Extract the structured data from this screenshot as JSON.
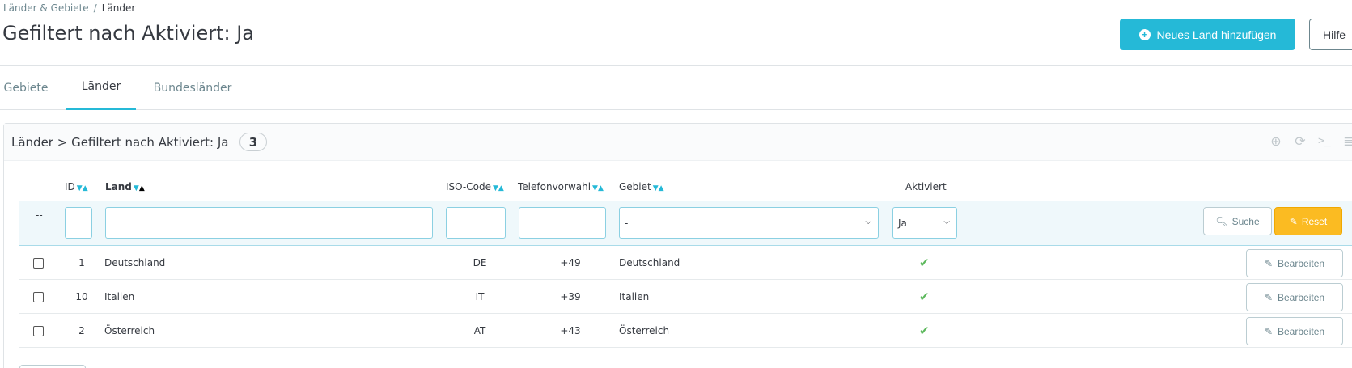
{
  "breadcrumb": {
    "parent": "Länder & Gebiete",
    "separator": "/",
    "current": "Länder"
  },
  "page": {
    "title": "Gefiltert nach Aktiviert: Ja"
  },
  "toolbar": {
    "add_label": "Neues Land hinzufügen",
    "help_label": "Hilfe"
  },
  "tabs": [
    {
      "label": "Gebiete",
      "active": false
    },
    {
      "label": "Länder",
      "active": true
    },
    {
      "label": "Bundesländer",
      "active": false
    }
  ],
  "panel": {
    "title": "Länder > Gefiltert nach Aktiviert: Ja",
    "count": "3",
    "tool_icons": [
      "add-circle-icon",
      "refresh-icon",
      "terminal-icon",
      "database-icon"
    ]
  },
  "table": {
    "columns": {
      "id": "ID",
      "land": "Land",
      "iso": "ISO-Code",
      "phone": "Telefonvorwahl",
      "zone": "Gebiet",
      "active": "Aktiviert"
    },
    "filters": {
      "bulk_dash": "--",
      "id_value": "",
      "land_value": "",
      "iso_value": "",
      "phone_value": "",
      "zone_selected": "-",
      "active_selected": "Ja",
      "search_label": "Suche",
      "reset_label": "Reset"
    },
    "rows": [
      {
        "id": "1",
        "land": "Deutschland",
        "iso": "DE",
        "phone": "+49",
        "zone": "Deutschland",
        "active": "✔",
        "edit": "Bearbeiten"
      },
      {
        "id": "10",
        "land": "Italien",
        "iso": "IT",
        "phone": "+39",
        "zone": "Italien",
        "active": "✔",
        "edit": "Bearbeiten"
      },
      {
        "id": "2",
        "land": "Österreich",
        "iso": "AT",
        "phone": "+43",
        "zone": "Österreich",
        "active": "✔",
        "edit": "Bearbeiten"
      }
    ]
  },
  "colors": {
    "accent": "#25b9d7",
    "reset": "#fbbb22",
    "check": "#5cb85c",
    "text": "#363a41"
  }
}
